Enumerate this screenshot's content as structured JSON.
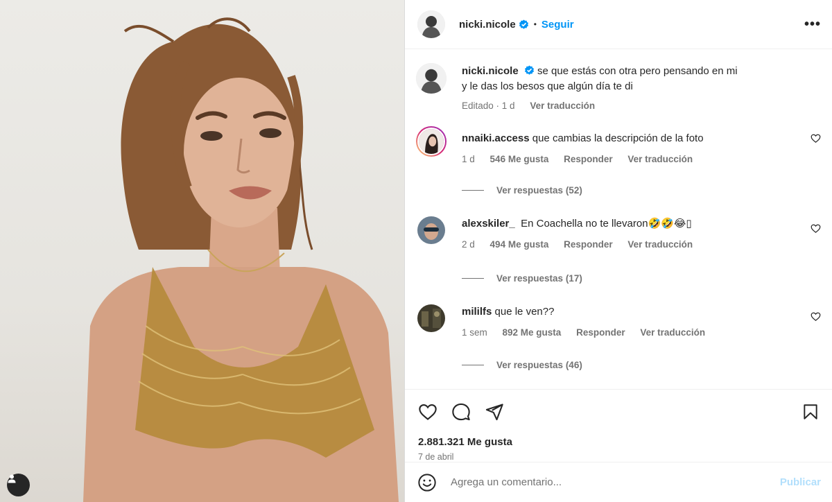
{
  "header": {
    "username": "nicki.nicole",
    "follow_label": "Seguir",
    "more_label": "•••"
  },
  "caption": {
    "username": "nicki.nicole",
    "text_line1": "se que estás con otra pero pensando en mi",
    "text_line2": "y le das los besos que algún día te di",
    "edited": "Editado · 1 d",
    "translate": "Ver traducción"
  },
  "comments": [
    {
      "username": "nnaiki.access",
      "text": "que cambias la descripción de la foto",
      "time": "1 d",
      "likes": "546 Me gusta",
      "reply": "Responder",
      "translate": "Ver traducción",
      "replies": "Ver respuestas (52)"
    },
    {
      "username": "alexskiler_",
      "text": "En Coachella no te llevaron🤣🤣😂▯",
      "time": "2 d",
      "likes": "494 Me gusta",
      "reply": "Responder",
      "translate": "Ver traducción",
      "replies": "Ver respuestas (17)"
    },
    {
      "username": "mililfs",
      "text": "que le ven??",
      "time": "1 sem",
      "likes": "892 Me gusta",
      "reply": "Responder",
      "translate": "Ver traducción",
      "replies": "Ver respuestas (46)"
    }
  ],
  "stats": {
    "likes": "2.881.321 Me gusta",
    "date": "7 de abril"
  },
  "composer": {
    "placeholder": "Agrega un comentario...",
    "publish_label": "Publicar"
  },
  "icons": {
    "verified": "verified-badge-icon",
    "like": "heart-icon",
    "comment": "comment-icon",
    "share": "paper-plane-icon",
    "save": "bookmark-icon",
    "emoji": "emoji-icon",
    "tagged_user": "user-tag-icon"
  },
  "colors": {
    "accent": "#0095f6",
    "verified": "#0095f6",
    "publish_disabled": "#b2dffc",
    "secondary_text": "#737373"
  }
}
